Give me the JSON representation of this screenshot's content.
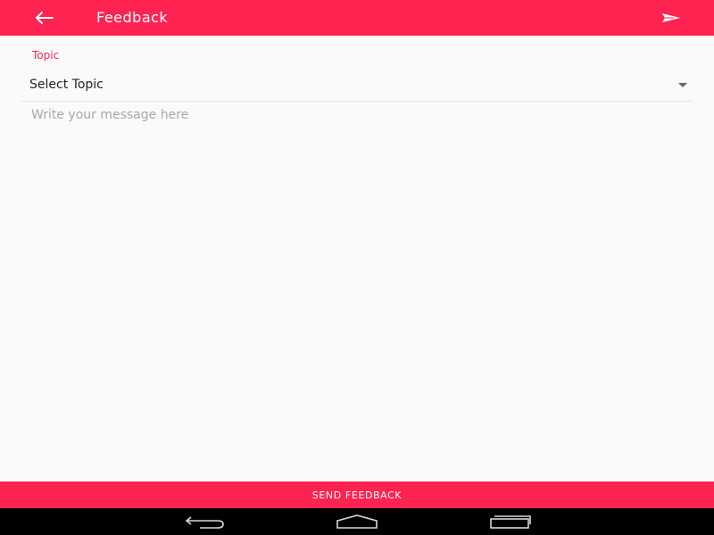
{
  "toolbar": {
    "title": "Feedback",
    "back_icon": "arrow-back-icon",
    "send_icon": "send-icon",
    "color": "#ff2352"
  },
  "form": {
    "topic_label": "Topic",
    "topic_selected": "Select Topic",
    "dropdown_icon": "caret-down-icon",
    "message_placeholder": "Write your message here",
    "message_value": ""
  },
  "actions": {
    "send_feedback_label": "SEND FEEDBACK"
  },
  "system_nav": {
    "icons": [
      "nav-back-icon",
      "nav-home-icon",
      "nav-recents-icon"
    ]
  }
}
